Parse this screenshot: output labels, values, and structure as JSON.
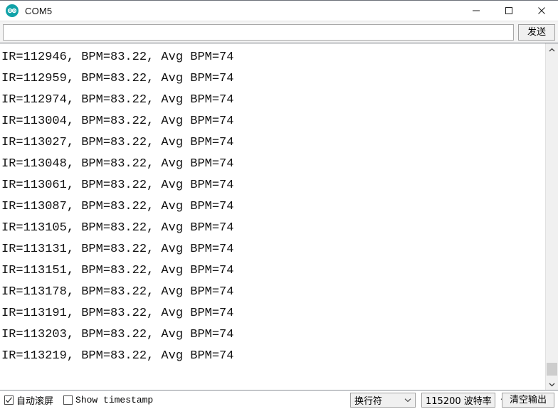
{
  "window": {
    "title": "COM5",
    "logo_icon": "arduino-logo-icon",
    "controls": {
      "minimize": "minimize-icon",
      "maximize": "maximize-icon",
      "close": "close-icon"
    }
  },
  "send_row": {
    "input_value": "",
    "input_placeholder": "",
    "send_label": "发送"
  },
  "console": {
    "lines": [
      "IR=112946, BPM=83.22, Avg BPM=74",
      "IR=112959, BPM=83.22, Avg BPM=74",
      "IR=112974, BPM=83.22, Avg BPM=74",
      "IR=113004, BPM=83.22, Avg BPM=74",
      "IR=113027, BPM=83.22, Avg BPM=74",
      "IR=113048, BPM=83.22, Avg BPM=74",
      "IR=113061, BPM=83.22, Avg BPM=74",
      "IR=113087, BPM=83.22, Avg BPM=74",
      "IR=113105, BPM=83.22, Avg BPM=74",
      "IR=113131, BPM=83.22, Avg BPM=74",
      "IR=113151, BPM=83.22, Avg BPM=74",
      "IR=113178, BPM=83.22, Avg BPM=74",
      "IR=113191, BPM=83.22, Avg BPM=74",
      "IR=113203, BPM=83.22, Avg BPM=74",
      "IR=113219, BPM=83.22, Avg BPM=74"
    ]
  },
  "scrollbar": {
    "up_icon": "chevron-up-icon",
    "down_icon": "chevron-down-icon"
  },
  "status_bar": {
    "autoscroll_label": "自动滚屏",
    "autoscroll_checked": true,
    "timestamp_label": "Show timestamp",
    "timestamp_checked": false,
    "newline_value": "换行符",
    "baud_value": "115200 波特率",
    "clear_label": "清空输出"
  },
  "colors": {
    "accent": "#10a2a8",
    "text": "#111111",
    "chrome": "#f0f0f0"
  }
}
